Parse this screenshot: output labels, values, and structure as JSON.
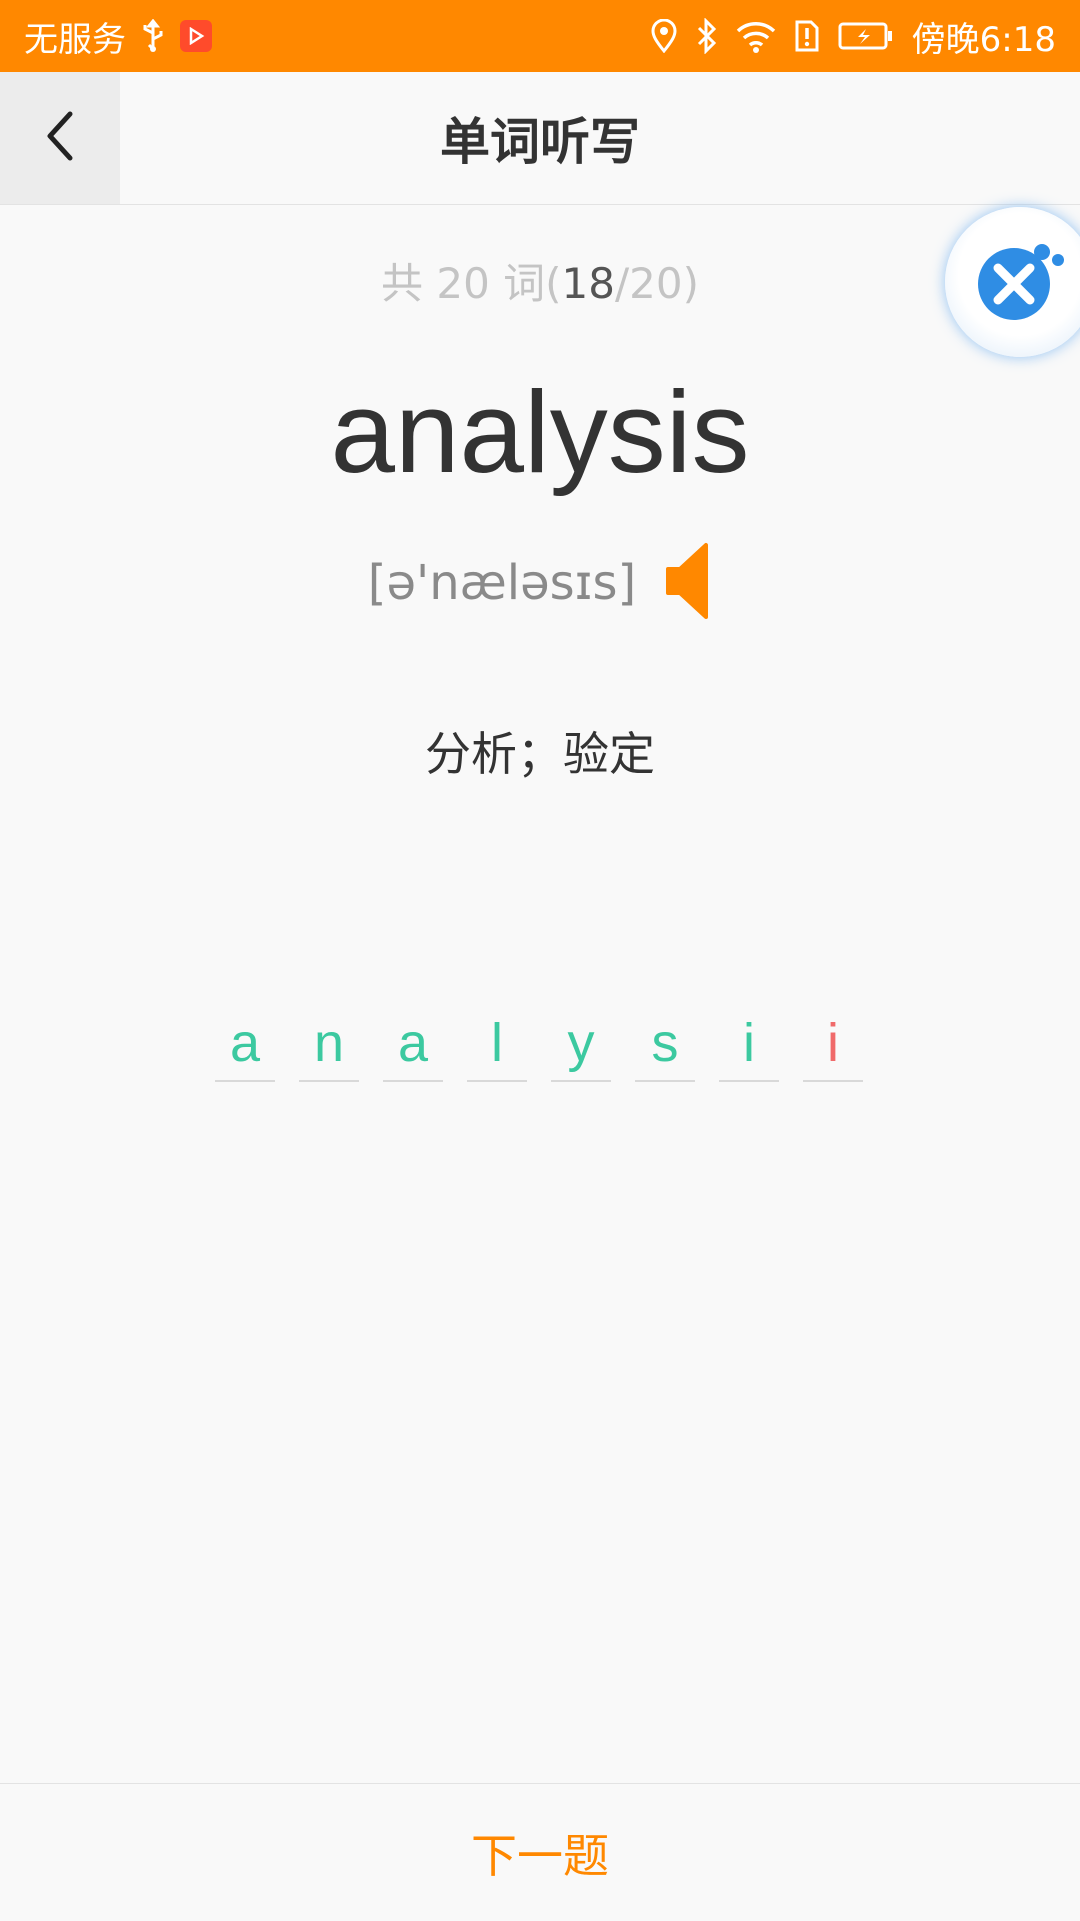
{
  "status_bar": {
    "carrier": "无服务",
    "time": "傍晚6:18",
    "background_color": "#ff8800",
    "icons": [
      "usb-icon",
      "media-app-icon",
      "location-icon",
      "bluetooth-icon",
      "wifi-icon",
      "sim-alert-icon",
      "battery-icon"
    ]
  },
  "header": {
    "title": "单词听写",
    "back_icon": "chevron-left-icon"
  },
  "progress": {
    "prefix": "共 20 词(",
    "current": "18",
    "suffix": "/20)"
  },
  "word": {
    "text": "analysis",
    "phonetic": "[ə'næləsɪs]",
    "meaning": "分析；验定"
  },
  "answer": {
    "letters": [
      {
        "char": "a",
        "correct": true
      },
      {
        "char": "n",
        "correct": true
      },
      {
        "char": "a",
        "correct": true
      },
      {
        "char": "l",
        "correct": true
      },
      {
        "char": "y",
        "correct": true
      },
      {
        "char": "s",
        "correct": true
      },
      {
        "char": "i",
        "correct": true
      },
      {
        "char": "i",
        "correct": false
      }
    ],
    "correct_color": "#3cc9a0",
    "wrong_color": "#f06a6a"
  },
  "footer": {
    "next_label": "下一题"
  },
  "colors": {
    "accent": "#ff8800",
    "assistant_blue": "#2f8de4"
  }
}
